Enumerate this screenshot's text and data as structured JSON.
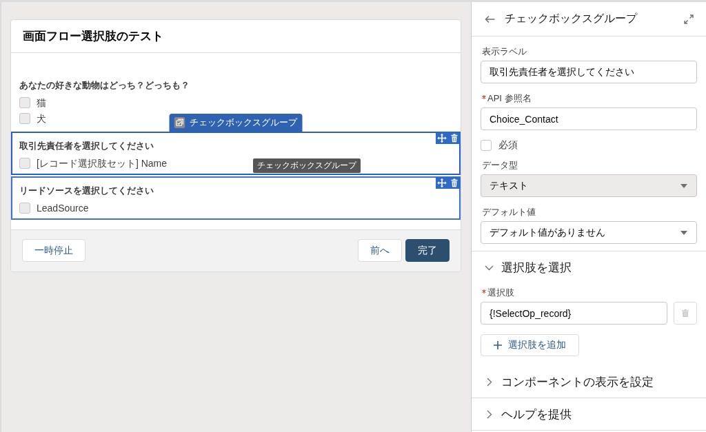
{
  "canvas": {
    "screen": {
      "title": "画面フロー選択肢のテスト",
      "components": [
        {
          "kind": "checkbox_group",
          "label": "あなたの好きな動物はどっち？どっちも？",
          "selected": false,
          "highlighted": false,
          "options": [
            {
              "label": "猫",
              "checked": false
            },
            {
              "label": "犬",
              "checked": false
            }
          ]
        },
        {
          "kind": "checkbox_group",
          "label": "取引先責任者を選択してください",
          "selected": true,
          "highlighted": true,
          "type_label": "チェックボックスグループ",
          "tooltip": "チェックボックスグループ",
          "options": [
            {
              "label": "[レコード選択肢セット] Name",
              "checked": false
            }
          ]
        },
        {
          "kind": "checkbox_group",
          "label": "リードソースを選択してください",
          "selected": false,
          "highlighted": true,
          "options": [
            {
              "label": "LeadSource",
              "checked": false
            }
          ]
        }
      ],
      "footer": {
        "left_buttons": [
          {
            "label": "一時停止",
            "kind": "neutral"
          }
        ],
        "right_buttons": [
          {
            "label": "前へ",
            "kind": "neutral"
          },
          {
            "label": "完了",
            "kind": "brand"
          }
        ]
      }
    }
  },
  "properties_panel": {
    "title": "チェックボックスグループ",
    "fields": [
      {
        "kind": "text",
        "label": "表示ラベル",
        "required": false,
        "value": "取引先責任者を選択してください"
      },
      {
        "kind": "text",
        "label": "API 参照名",
        "required": true,
        "value": "Choice_Contact"
      },
      {
        "kind": "checkbox",
        "label": "必須",
        "checked": false
      },
      {
        "kind": "select",
        "label": "データ型",
        "disabled": true,
        "value": "テキスト"
      },
      {
        "kind": "select",
        "label": "デフォルト値",
        "disabled": false,
        "value": "デフォルト値がありません"
      }
    ],
    "sections": [
      {
        "title": "選択肢を選択",
        "expanded": true,
        "choices": {
          "label": "選択肢",
          "required": true,
          "items": [
            {
              "value": "{!SelectOp_record}",
              "delete_disabled": true
            }
          ],
          "add_button": "選択肢を追加"
        }
      },
      {
        "title": "コンポーネントの表示を設定",
        "expanded": false
      },
      {
        "title": "ヘルプを提供",
        "expanded": false
      }
    ]
  }
}
